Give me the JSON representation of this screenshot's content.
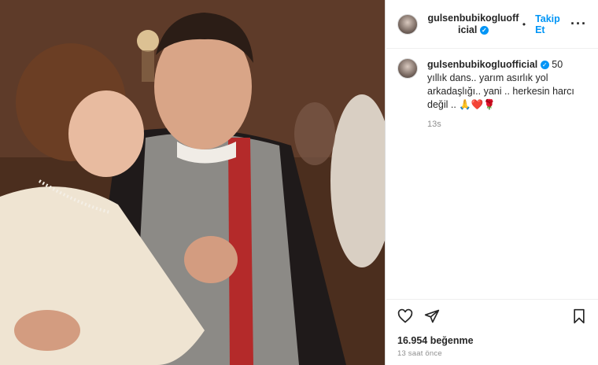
{
  "post": {
    "username": "gulsenbubikogluofficial",
    "follow_label": "Takip Et",
    "more_icon": "more-horizontal-icon",
    "caption": {
      "username": "gulsenbubikogluofficial",
      "text": "50 yıllık dans.. yarım asırlık yol arkadaşlığı.. yani .. herkesin harcı değil .. 🙏❤️🌹",
      "time": "13s"
    },
    "likes": "16.954 beğenme",
    "posted_ago": "13 saat önce"
  },
  "icons": [
    "heart-icon",
    "share-icon",
    "bookmark-icon",
    "verified-badge-icon"
  ],
  "colors": {
    "accent": "#0095f6",
    "muted": "#8e8e8e",
    "text": "#262626"
  }
}
